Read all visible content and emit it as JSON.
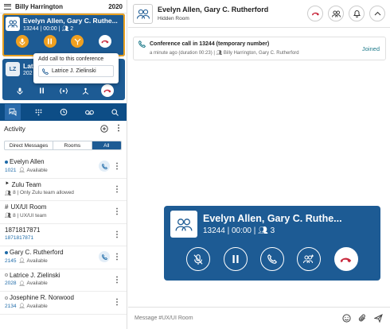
{
  "app": {
    "user_name": "Billy Harrington",
    "extension": "2020"
  },
  "calls": [
    {
      "avatar_icon": "group-icon",
      "name": "Evelyn Allen, Gary C. Ruthe...",
      "number": "13244",
      "timer": "00:00",
      "participants": "2"
    },
    {
      "avatar_initials": "LZ",
      "name": "Lat",
      "number": "202"
    }
  ],
  "popup": {
    "title": "Add call to this conference",
    "item": "Latrice J. Zielinski"
  },
  "activity": {
    "title": "Activity",
    "tabs": [
      "Direct Messages",
      "Rooms",
      "All"
    ],
    "active_tab": "All",
    "items": [
      {
        "name": "Evelyn Allen",
        "number": "1021",
        "status": "Available",
        "type": "contact",
        "online": true,
        "call": true
      },
      {
        "name": "Zulu Team",
        "count": "8",
        "status": "Only Zulu team allowed",
        "type": "room"
      },
      {
        "name": "UX/UI Room",
        "count": "8",
        "status": "UX/UI team",
        "type": "room",
        "hash": "#"
      },
      {
        "name": "1871817871",
        "number": "1871817871",
        "type": "number"
      },
      {
        "name": "Gary C. Rutherford",
        "number": "2145",
        "status": "Available",
        "type": "contact",
        "online": true,
        "call": true
      },
      {
        "name": "Latrice J. Zielinski",
        "number": "2028",
        "status": "Available",
        "type": "contact"
      },
      {
        "name": "Josephine R. Norwood",
        "number": "2134",
        "status": "Available",
        "type": "contact"
      }
    ]
  },
  "room": {
    "title": "Evelyn Allen, Gary C. Rutherford",
    "subtitle": "Hidden Room"
  },
  "message": {
    "title": "Conference call in 13244 (temporary number)",
    "time": "a minute ago (duration 00:23)",
    "participants": "Billy Harrington, Gary C. Rutherford",
    "status": "Joined"
  },
  "big_call": {
    "name": "Evelyn Allen, Gary C. Ruthe...",
    "number": "13244",
    "timer": "00:00",
    "participants": "3"
  },
  "composer": {
    "placeholder": "Message #UX/UI Room"
  },
  "colors": {
    "brand": "#1d5b94",
    "nav": "#0d4d86",
    "hangup": "#c8283c",
    "hold": "#f0a020"
  }
}
